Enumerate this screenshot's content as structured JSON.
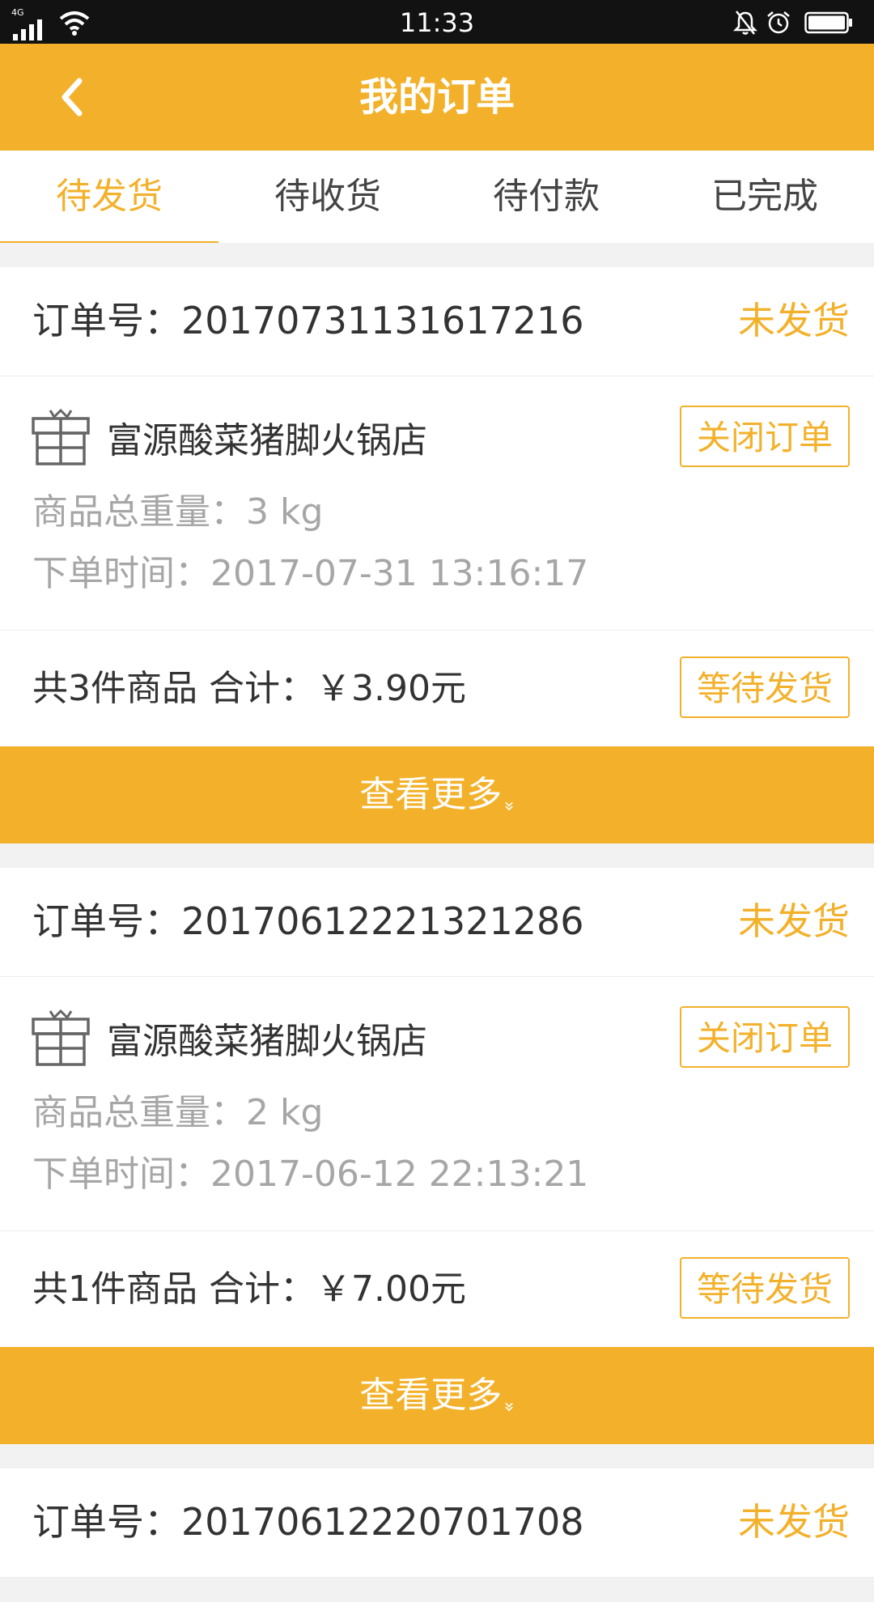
{
  "status_bar": {
    "network": "4G",
    "time": "11:33"
  },
  "header": {
    "title": "我的订单"
  },
  "tabs": [
    {
      "label": "待发货",
      "active": true
    },
    {
      "label": "待收货",
      "active": false
    },
    {
      "label": "待付款",
      "active": false
    },
    {
      "label": "已完成",
      "active": false
    }
  ],
  "colors": {
    "accent": "#f3b12b",
    "status_bar": "#121212"
  },
  "orders": [
    {
      "order_no": "订单号：20170731131617216",
      "status": "未发货",
      "shop": "富源酸菜猪脚火锅店",
      "weight": "商品总重量：3 kg",
      "time": "下单时间：2017-07-31 13:16:17",
      "close_btn": "关闭订单",
      "total": "共3件商品 合计：￥3.90元",
      "wait_btn": "等待发货",
      "view_more": "查看更多",
      "view_more_icon": "double-chevron-down-icon"
    },
    {
      "order_no": "订单号：20170612221321286",
      "status": "未发货",
      "shop": "富源酸菜猪脚火锅店",
      "weight": "商品总重量：2 kg",
      "time": "下单时间：2017-06-12 22:13:21",
      "close_btn": "关闭订单",
      "total": "共1件商品 合计：￥7.00元",
      "wait_btn": "等待发货",
      "view_more": "查看更多",
      "view_more_icon": "double-chevron-down-icon"
    },
    {
      "order_no": "订单号：20170612220701708",
      "status": "未发货"
    }
  ]
}
